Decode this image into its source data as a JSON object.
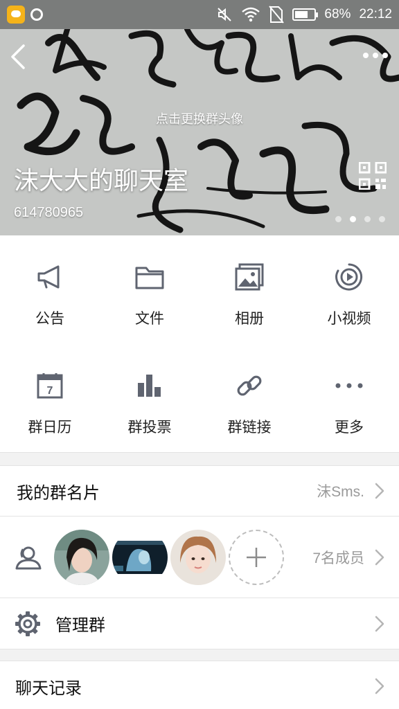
{
  "status_bar": {
    "battery_percent": "68%",
    "battery_level": 0.68,
    "time": "22:12",
    "icons": [
      "chat-app-icon",
      "record-icon",
      "mute-icon",
      "wifi-icon",
      "no-sim-icon",
      "battery-icon"
    ]
  },
  "header": {
    "change_avatar_hint": "点击更换群头像",
    "group_name": "沫大大的聊天室",
    "group_id": "614780965",
    "page_dots": 4,
    "active_dot": 1
  },
  "functions": [
    {
      "label": "公告",
      "icon": "megaphone-icon"
    },
    {
      "label": "文件",
      "icon": "folder-icon"
    },
    {
      "label": "相册",
      "icon": "album-icon"
    },
    {
      "label": "小视频",
      "icon": "video-icon"
    },
    {
      "label": "群日历",
      "icon": "calendar-icon",
      "calendar_day": "7"
    },
    {
      "label": "群投票",
      "icon": "bar-chart-icon"
    },
    {
      "label": "群链接",
      "icon": "link-icon"
    },
    {
      "label": "更多",
      "icon": "more-dots-icon"
    }
  ],
  "my_card": {
    "title": "我的群名片",
    "value": "沫Sms."
  },
  "members": {
    "count_label": "7名成员"
  },
  "manage": {
    "title": "管理群"
  },
  "history": {
    "title": "聊天记录"
  },
  "colors": {
    "icon_gray": "#5f6470",
    "divider": "#e3e3e3",
    "background": "#f2f2f2"
  }
}
